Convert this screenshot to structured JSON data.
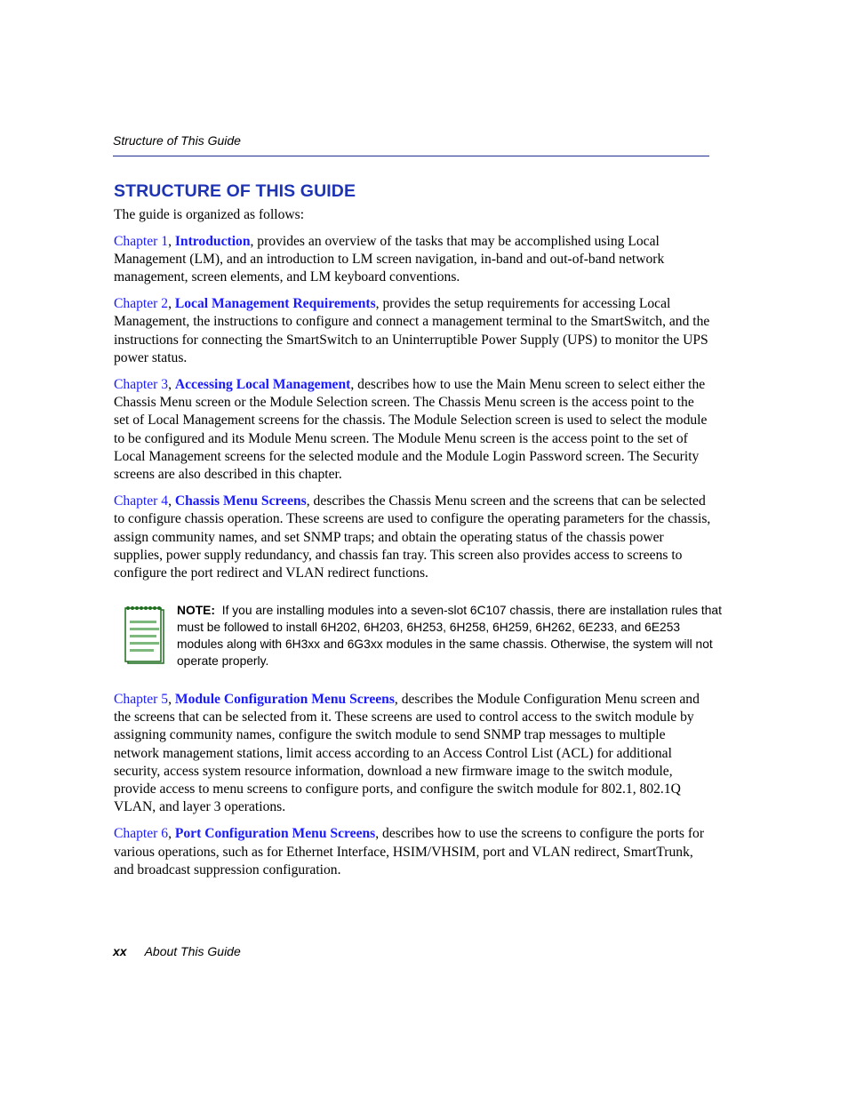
{
  "header": {
    "running_title": "Structure of This Guide"
  },
  "section": {
    "title": "STRUCTURE OF THIS GUIDE",
    "intro": "The guide is organized as follows:"
  },
  "chapters": [
    {
      "ref": "Chapter 1",
      "title": "Introduction",
      "description": ", provides an overview of the tasks that may be accomplished using Local Management (LM), and an introduction to LM screen navigation, in-band and out-of-band network management, screen elements, and LM keyboard conventions."
    },
    {
      "ref": "Chapter 2",
      "title": "Local Management Requirements",
      "description": ", provides the setup requirements for accessing Local Management, the instructions to configure and connect a management terminal to the SmartSwitch, and the instructions for connecting the SmartSwitch to an Uninterruptible Power Supply (UPS) to monitor the UPS power status."
    },
    {
      "ref": "Chapter 3",
      "title": "Accessing Local Management",
      "description": ", describes how to use the Main Menu screen to select either the Chassis Menu screen or the Module Selection screen. The Chassis Menu screen is the access point to the set of Local Management screens for the chassis. The Module Selection screen is used to select the module to be configured and its Module Menu screen. The Module Menu screen is the access point to the set of Local Management screens for the selected module and the Module Login Password screen. The Security screens are also described in this chapter."
    },
    {
      "ref": "Chapter 4",
      "title": "Chassis Menu Screens",
      "description": ", describes the Chassis Menu screen and the screens that can be selected to configure chassis operation. These screens are used to configure the operating parameters for the chassis, assign community names, and set SNMP traps; and obtain the operating status of the chassis power supplies, power supply redundancy, and chassis fan tray. This screen also provides access to screens to configure the port redirect and VLAN redirect functions."
    },
    {
      "ref": "Chapter 5",
      "title": "Module Configuration Menu Screens",
      "description": ", describes the Module Configuration Menu screen and the screens that can be selected from it. These screens are used to control access to the switch module by assigning community names, configure the switch module to send SNMP trap messages to multiple network management stations, limit access according to an Access Control List (ACL) for additional security, access system resource information, download a new firmware image to the switch module, provide access to menu screens to configure ports, and configure the switch module for 802.1, 802.1Q VLAN, and layer 3 operations."
    },
    {
      "ref": "Chapter 6",
      "title": "Port Configuration Menu Screens",
      "description": ", describes how to use the screens to configure the ports for various operations, such as for Ethernet Interface, HSIM/VHSIM, port and VLAN redirect, SmartTrunk, and broadcast suppression configuration."
    }
  ],
  "note": {
    "icon": "notepad-icon",
    "label": "NOTE:",
    "text": "If you are installing modules into a seven-slot 6C107 chassis, there are installation rules that must be followed to install 6H202, 6H203, 6H253, 6H258, 6H259, 6H262, 6E233, and 6E253 modules along with 6H3xx and 6G3xx modules in the same chassis. Otherwise, the system will not operate properly."
  },
  "footer": {
    "page_number": "xx",
    "running_title": "About This Guide"
  },
  "colors": {
    "heading": "#1e34b4",
    "link": "#1a1aff",
    "rule": "#1f2f8f",
    "note_icon_green": "#1e6e1e",
    "note_icon_lines": "#7db87d"
  }
}
